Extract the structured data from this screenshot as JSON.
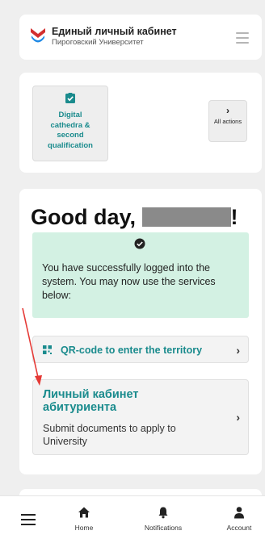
{
  "header": {
    "title": "Единый личный кабинет",
    "subtitle": "Пироговский Университет"
  },
  "quick_actions": {
    "digital": {
      "label_lines": [
        "Digital",
        "cathedra &",
        "second",
        "qualification"
      ],
      "icon": "clipboard-check-icon"
    },
    "all": {
      "chevron": "›",
      "label": "All actions"
    }
  },
  "greeting": {
    "title_prefix": "Good day,",
    "title_suffix": "!",
    "alert_message": "You have successfully logged into the system. You may now use the services below:",
    "qr_label": "QR-code to enter the territory",
    "lk_title": "Личный кабинет абитуриента",
    "lk_description": "Submit documents to apply to University"
  },
  "bottom_nav": {
    "home": "Home",
    "notifications": "Notifications",
    "account": "Account"
  },
  "colors": {
    "accent": "#1a8b8d",
    "alert_bg": "#d3f1e3",
    "annotation_arrow": "#e53935"
  }
}
